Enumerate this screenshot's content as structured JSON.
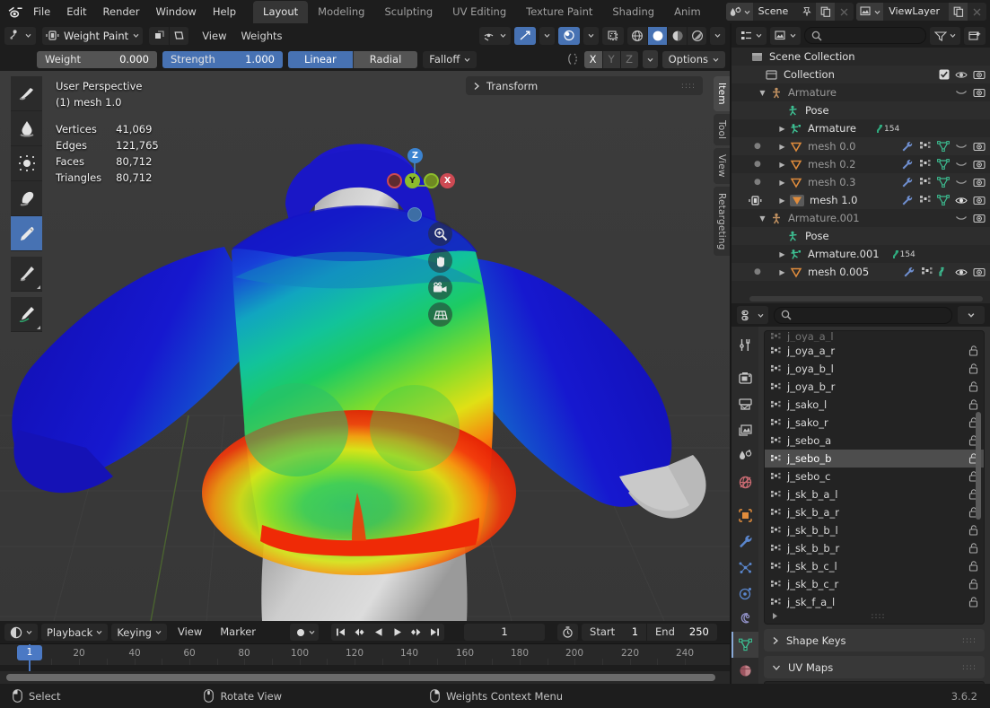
{
  "app": {
    "version": "3.6.2"
  },
  "topbar": {
    "logo_icon": "blender-logo-icon",
    "menus": [
      "File",
      "Edit",
      "Render",
      "Window",
      "Help"
    ],
    "workspace_tabs": [
      {
        "label": "Layout",
        "active": true
      },
      {
        "label": "Modeling",
        "active": false
      },
      {
        "label": "Sculpting",
        "active": false
      },
      {
        "label": "UV Editing",
        "active": false
      },
      {
        "label": "Texture Paint",
        "active": false
      },
      {
        "label": "Shading",
        "active": false
      },
      {
        "label": "Anim",
        "active": false
      }
    ],
    "scene_field": {
      "icon": "scene-icon",
      "value": "Scene",
      "pin_icon": "pin-icon",
      "new_icon": "duplicate-icon",
      "x_icon": "close-icon"
    },
    "viewlayer_field": {
      "icon": "viewlayer-icon",
      "value": "ViewLayer",
      "new_icon": "duplicate-icon",
      "x_icon": "close-icon"
    }
  },
  "viewport_header": {
    "editor_type_icon": "editor-type-3dview-icon",
    "mode": "Weight Paint",
    "mode_icon": "weight-paint-mode-icon",
    "menus": [
      "View",
      "Weights"
    ],
    "select_mode_icons": [
      "vertex-select-icon",
      "face-select-icon"
    ],
    "right_icons": [
      "visibility-icon",
      "snap-magnet-icon",
      "proportional-edit-icon",
      "transform-orientation-icon"
    ],
    "shading_modes": [
      "wireframe-shading-icon",
      "solid-shading-icon",
      "material-shading-icon",
      "rendered-shading-icon"
    ],
    "shading_active_index": 1,
    "symmetry_icon": "symmetry-icon",
    "symmetry_axes": [
      {
        "label": "X",
        "on": true
      },
      {
        "label": "Y",
        "on": false
      },
      {
        "label": "Z",
        "on": false
      }
    ],
    "options_label": "Options"
  },
  "tool_settings": {
    "weight": {
      "label": "Weight",
      "value": "0.000"
    },
    "strength": {
      "label": "Strength",
      "value": "1.000"
    },
    "falloff_shape": [
      {
        "label": "Linear",
        "on": true
      },
      {
        "label": "Radial",
        "on": false
      }
    ],
    "falloff_label": "Falloff"
  },
  "toolbar": {
    "tools": [
      {
        "name": "draw-tool",
        "selected": false
      },
      {
        "name": "blur-tool",
        "selected": false
      },
      {
        "name": "average-tool",
        "selected": false
      },
      {
        "name": "smear-tool",
        "selected": false
      },
      {
        "name": "gradient-tool",
        "selected": true
      },
      {
        "name": "sample-weight-tool",
        "selected": false
      },
      {
        "name": "annotate-tool",
        "selected": false
      }
    ]
  },
  "viewport": {
    "stats": {
      "perspective": "User Perspective",
      "object": "(1) mesh 1.0",
      "rows": [
        {
          "label": "Vertices",
          "value": "41,069"
        },
        {
          "label": "Edges",
          "value": "121,765"
        },
        {
          "label": "Faces",
          "value": "80,712"
        },
        {
          "label": "Triangles",
          "value": "80,712"
        }
      ]
    },
    "gizmo": {
      "axes": [
        {
          "label": "Z",
          "color": "#3b83d0",
          "filled": true
        },
        {
          "label": "Y",
          "color": "#8cbd2c",
          "filled": true
        },
        {
          "label": "X",
          "color": "#cd4a53",
          "filled": true
        },
        {
          "label": "",
          "color": "#8cbd2c",
          "filled": false
        },
        {
          "label": "",
          "color": "#cd4a53",
          "filled": false
        }
      ]
    },
    "nav_buttons": [
      "zoom-icon",
      "pan-hand-icon",
      "camera-view-icon",
      "toggle-perspective-icon"
    ],
    "sidebar_tabs": [
      {
        "label": "Item",
        "active": true
      },
      {
        "label": "Tool",
        "active": false
      },
      {
        "label": "View",
        "active": false
      },
      {
        "label": "Retargeting",
        "active": false
      }
    ],
    "transform_panel": {
      "label": "Transform",
      "collapsed": true
    }
  },
  "outliner": {
    "display_mode_icon": "outliner-display-mode-icon",
    "filter_icon": "filter-icon",
    "new_collection_icon": "new-collection-icon",
    "search_icon": "search-icon",
    "search_placeholder": "",
    "rows": [
      {
        "indent": 0,
        "icon": "scene-collection-icon",
        "label": "Scene Collection",
        "dim": false,
        "disclosure": "",
        "icons": []
      },
      {
        "indent": 1,
        "icon": "collection-icon",
        "label": "Collection",
        "dim": false,
        "disclosure": "",
        "icons": [
          "checkbox-checked",
          "eye-icon",
          "camera-icon"
        ]
      },
      {
        "indent": 2,
        "icon": "armature-object-icon",
        "label": "Armature",
        "dim": true,
        "disclosure": "down",
        "icons": [
          "eye-closed-icon",
          "camera-icon"
        ]
      },
      {
        "indent": 3,
        "icon": "pose-icon",
        "label": "Pose",
        "dim": false,
        "disclosure": "",
        "icons": []
      },
      {
        "indent": 3,
        "icon": "armature-data-icon",
        "label": "Armature",
        "dim": false,
        "disclosure": "right",
        "badge": "154",
        "icons": []
      },
      {
        "indent": 3,
        "icon": "mesh-data-icon",
        "label": "mesh 0.0",
        "dim": true,
        "disclosure": "right",
        "icons": [
          "modifier-icon",
          "vertexgroup-icon",
          "mesh-icon",
          "eye-closed-icon",
          "camera-icon"
        ],
        "dot": true
      },
      {
        "indent": 3,
        "icon": "mesh-data-icon",
        "label": "mesh 0.2",
        "dim": true,
        "disclosure": "right",
        "icons": [
          "modifier-icon",
          "vertexgroup-icon",
          "mesh-icon",
          "eye-closed-icon",
          "camera-icon"
        ],
        "dot": true
      },
      {
        "indent": 3,
        "icon": "mesh-data-icon",
        "label": "mesh 0.3",
        "dim": true,
        "disclosure": "right",
        "icons": [
          "modifier-icon",
          "vertexgroup-icon",
          "mesh-icon",
          "eye-closed-icon",
          "camera-icon"
        ],
        "dot": true
      },
      {
        "indent": 3,
        "icon": "mesh-data-icon",
        "label": "mesh 1.0",
        "dim": false,
        "disclosure": "right",
        "icons": [
          "modifier-icon",
          "vertexgroup-icon",
          "mesh-icon",
          "eye-icon",
          "camera-icon"
        ],
        "active": true,
        "mode_icon": "weight-paint-mode-icon"
      },
      {
        "indent": 2,
        "icon": "armature-object-icon",
        "label": "Armature.001",
        "dim": true,
        "disclosure": "down",
        "icons": [
          "eye-closed-icon",
          "camera-icon"
        ]
      },
      {
        "indent": 3,
        "icon": "pose-icon",
        "label": "Pose",
        "dim": false,
        "disclosure": "",
        "icons": []
      },
      {
        "indent": 3,
        "icon": "armature-data-icon",
        "label": "Armature.001",
        "dim": false,
        "disclosure": "right",
        "badge": "154",
        "icons": []
      },
      {
        "indent": 3,
        "icon": "mesh-data-icon",
        "label": "mesh 0.005",
        "dim": false,
        "disclosure": "right",
        "icons": [
          "modifier-icon",
          "vertexgroup-icon",
          "armature-mod-icon",
          "eye-icon",
          "camera-icon"
        ],
        "dot": true
      }
    ]
  },
  "properties": {
    "editor_type_icon": "properties-editor-icon",
    "search_icon": "search-icon",
    "search_placeholder": "",
    "expand_icon": "chevron-down-icon",
    "tabs": [
      {
        "name": "tool-tab",
        "selected": false
      },
      {
        "name": "render-tab",
        "selected": false
      },
      {
        "name": "output-tab",
        "selected": false
      },
      {
        "name": "view-layer-tab",
        "selected": false
      },
      {
        "name": "scene-tab",
        "selected": false
      },
      {
        "name": "world-tab",
        "selected": false
      },
      {
        "name": "object-tab",
        "selected": false
      },
      {
        "name": "modifier-tab",
        "selected": false
      },
      {
        "name": "particles-tab",
        "selected": false
      },
      {
        "name": "physics-tab",
        "selected": false
      },
      {
        "name": "constraints-tab",
        "selected": false
      },
      {
        "name": "object-data-tab",
        "selected": true
      },
      {
        "name": "material-tab",
        "selected": false
      }
    ],
    "vertex_groups": {
      "items": [
        {
          "name": "j_oya_a_r",
          "selected": false
        },
        {
          "name": "j_oya_b_l",
          "selected": false
        },
        {
          "name": "j_oya_b_r",
          "selected": false
        },
        {
          "name": "j_sako_l",
          "selected": false
        },
        {
          "name": "j_sako_r",
          "selected": false
        },
        {
          "name": "j_sebo_a",
          "selected": false
        },
        {
          "name": "j_sebo_b",
          "selected": true
        },
        {
          "name": "j_sebo_c",
          "selected": false
        },
        {
          "name": "j_sk_b_a_l",
          "selected": false
        },
        {
          "name": "j_sk_b_a_r",
          "selected": false
        },
        {
          "name": "j_sk_b_b_l",
          "selected": false
        },
        {
          "name": "j_sk_b_b_r",
          "selected": false
        },
        {
          "name": "j_sk_b_c_l",
          "selected": false
        },
        {
          "name": "j_sk_b_c_r",
          "selected": false
        },
        {
          "name": "j_sk_f_a_l",
          "selected": false
        }
      ],
      "lock_icon": "unlocked-icon",
      "group_icon": "vertexgroup-icon"
    },
    "panels": [
      {
        "label": "Shape Keys",
        "collapsed": true
      },
      {
        "label": "UV Maps",
        "collapsed": false
      }
    ]
  },
  "timeline": {
    "editor_type_icon": "editor-type-timeline-icon",
    "menus": [
      {
        "label": "Playback",
        "dropdown": true
      },
      {
        "label": "Keying",
        "dropdown": true
      },
      {
        "label": "View",
        "dropdown": false
      },
      {
        "label": "Marker",
        "dropdown": false
      }
    ],
    "record_icon": "record-keyframe-icon",
    "transport_icons": [
      "jump-start-icon",
      "prev-keyframe-icon",
      "play-reverse-icon",
      "play-icon",
      "next-keyframe-icon",
      "jump-end-icon"
    ],
    "current_frame": "1",
    "timer_icon": "auto-key-icon",
    "start": {
      "label": "Start",
      "value": "1"
    },
    "end": {
      "label": "End",
      "value": "250"
    },
    "ruler_ticks": [
      "20",
      "40",
      "60",
      "80",
      "100",
      "120",
      "140",
      "160",
      "180",
      "200",
      "220",
      "240"
    ],
    "playhead_label": "1"
  },
  "status_bar": {
    "items": [
      {
        "icon": "mouse-left-icon",
        "label": "Select"
      },
      {
        "icon": "mouse-middle-icon",
        "label": "Rotate View"
      },
      {
        "icon": "mouse-right-icon",
        "label": "Weights Context Menu"
      }
    ],
    "version": "3.6.2"
  },
  "colors": {
    "accent": "#4772b3",
    "header_bg": "#1d1d1d",
    "panel_bg": "#303030",
    "outliner_bg": "#282828",
    "viewport_bg": "#393939",
    "selected_row": "#4d4d4d"
  }
}
